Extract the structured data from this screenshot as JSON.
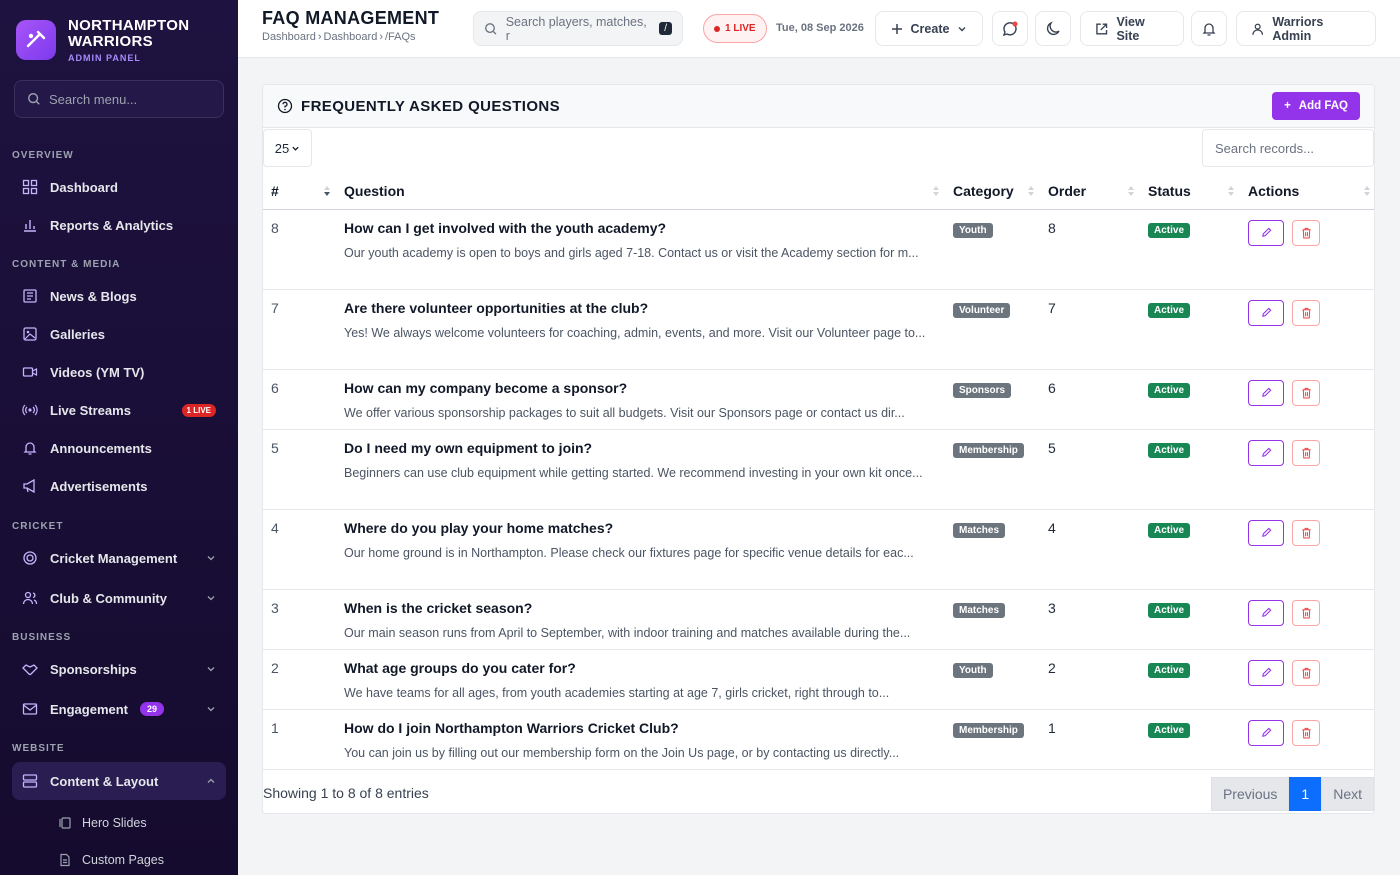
{
  "brand": {
    "name_line1": "NORTHAMPTON",
    "name_line2": "WARRIORS",
    "subtitle": "ADMIN PANEL"
  },
  "sidebar": {
    "search_placeholder": "Search menu...",
    "sections": [
      "OVERVIEW",
      "CONTENT & MEDIA",
      "CRICKET",
      "BUSINESS",
      "WEBSITE"
    ],
    "items": [
      {
        "label": "Dashboard"
      },
      {
        "label": "Reports & Analytics"
      },
      {
        "label": "News & Blogs"
      },
      {
        "label": "Galleries"
      },
      {
        "label": "Videos (YM TV)"
      },
      {
        "label": "Live Streams",
        "badge": "1 LIVE"
      },
      {
        "label": "Announcements"
      },
      {
        "label": "Advertisements"
      },
      {
        "label": "Cricket Management"
      },
      {
        "label": "Club & Community"
      },
      {
        "label": "Sponsorships"
      },
      {
        "label": "Engagement",
        "badge": "29"
      },
      {
        "label": "Content & Layout"
      }
    ],
    "subitems": [
      {
        "label": "Hero Slides"
      },
      {
        "label": "Custom Pages"
      }
    ]
  },
  "header": {
    "title": "FAQ MANAGEMENT",
    "breadcrumb": [
      "Dashboard",
      "Dashboard",
      "/FAQs"
    ],
    "search_placeholder": "Search players, matches, r",
    "search_kbd": "/",
    "live_label": "1 LIVE",
    "date": "Tue, 08 Sep 2026",
    "create_label": "Create",
    "view_site_label": "View Site",
    "user_label": "Warriors Admin"
  },
  "card": {
    "title": "FREQUENTLY ASKED QUESTIONS",
    "add_label": "Add FAQ",
    "page_length": "25",
    "search_placeholder": "Search records...",
    "columns": [
      "#",
      "Question",
      "Category",
      "Order",
      "Status",
      "Actions"
    ],
    "rows": [
      {
        "id": "8",
        "question": "How can I get involved with the youth academy?",
        "answer": "Our youth academy is open to boys and girls aged 7-18. Contact us or visit the Academy section for m...",
        "category": "Youth",
        "order": "8",
        "status": "Active"
      },
      {
        "id": "7",
        "question": "Are there volunteer opportunities at the club?",
        "answer": "Yes! We always welcome volunteers for coaching, admin, events, and more. Visit our Volunteer page to...",
        "category": "Volunteer",
        "order": "7",
        "status": "Active"
      },
      {
        "id": "6",
        "question": "How can my company become a sponsor?",
        "answer": "We offer various sponsorship packages to suit all budgets. Visit our Sponsors page or contact us dir...",
        "category": "Sponsors",
        "order": "6",
        "status": "Active"
      },
      {
        "id": "5",
        "question": "Do I need my own equipment to join?",
        "answer": "Beginners can use club equipment while getting started. We recommend investing in your own kit once...",
        "category": "Membership",
        "order": "5",
        "status": "Active"
      },
      {
        "id": "4",
        "question": "Where do you play your home matches?",
        "answer": "Our home ground is in Northampton. Please check our fixtures page for specific venue details for eac...",
        "category": "Matches",
        "order": "4",
        "status": "Active"
      },
      {
        "id": "3",
        "question": "When is the cricket season?",
        "answer": "Our main season runs from April to September, with indoor training and matches available during the...",
        "category": "Matches",
        "order": "3",
        "status": "Active"
      },
      {
        "id": "2",
        "question": "What age groups do you cater for?",
        "answer": "We have teams for all ages, from youth academies starting at age 7, girls cricket, right through to...",
        "category": "Youth",
        "order": "2",
        "status": "Active"
      },
      {
        "id": "1",
        "question": "How do I join Northampton Warriors Cricket Club?",
        "answer": "You can join us by filling out our membership form on the Join Us page, or by contacting us directly...",
        "category": "Membership",
        "order": "1",
        "status": "Active"
      }
    ],
    "footer_info": "Showing 1 to 8 of 8 entries",
    "pager": {
      "prev": "Previous",
      "current": "1",
      "next": "Next"
    }
  }
}
